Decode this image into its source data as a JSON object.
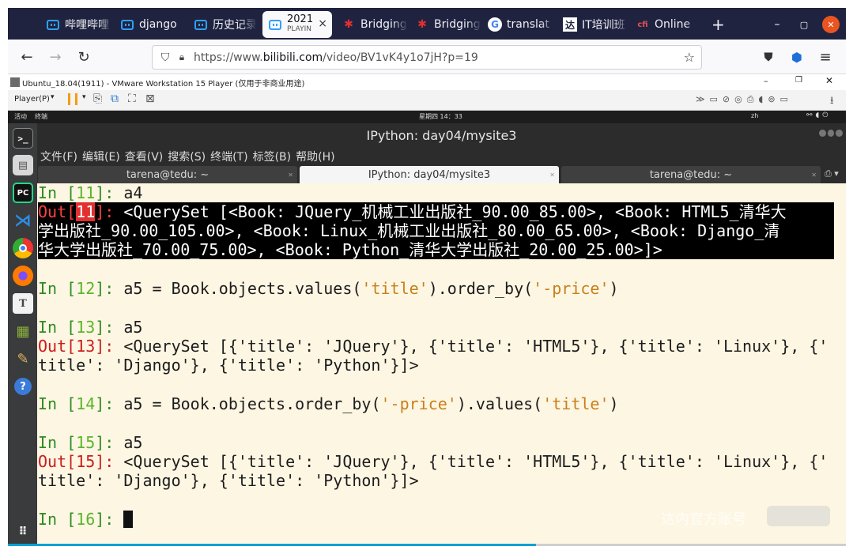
{
  "browser": {
    "tabs": [
      {
        "icon": "bilibili-icon",
        "label": "哔哩哔哩"
      },
      {
        "icon": "bilibili-icon",
        "label": "django"
      },
      {
        "icon": "bilibili-icon",
        "label": "历史记录"
      },
      {
        "icon": "bilibili-icon",
        "label": "2021",
        "sub": "PLAYIN"
      },
      {
        "icon": "maple-leaf-icon",
        "label": "Bridging"
      },
      {
        "icon": "maple-leaf-icon",
        "label": "Bridging"
      },
      {
        "icon": "google-icon",
        "label": "translat"
      },
      {
        "icon": "tarena-icon",
        "label": "IT培训班"
      },
      {
        "icon": "cfi-icon",
        "label": "Online"
      }
    ],
    "new_tab": "+",
    "close_tab": "×",
    "window_controls": {
      "minimize": "–",
      "maximize": "▢",
      "close": "✕"
    },
    "url_prefix": "https://www.",
    "url_domain": "bilibili.com",
    "url_path": "/video/BV1vK4y1o7jH?p=19"
  },
  "vmware": {
    "title": "Ubuntu_18.04(1911) - VMware Workstation 15 Player (仅用于非商业用途)",
    "player_menu": "Player(P)"
  },
  "ubuntu": {
    "activities": "活动",
    "app_menu": "终端",
    "clock": "星期四 14：33",
    "input_method": "zh"
  },
  "terminal": {
    "title": "IPython: day04/mysite3",
    "menu": [
      "文件(F)",
      "编辑(E)",
      "查看(V)",
      "搜索(S)",
      "终端(T)",
      "标签(B)",
      "帮助(H)"
    ],
    "tabs": [
      "tarena@tedu: ~",
      "IPython: day04/mysite3",
      "tarena@tedu: ~"
    ],
    "lines": {
      "l0": {
        "prompt": "In [",
        "num": "11",
        "end": "]: ",
        "code": "a4"
      },
      "l1": {
        "prompt": "Out[",
        "num": "11",
        "end": "]: ",
        "text": "<QuerySet [<Book: JQuery_机械工业出版社_90.00_85.00>, <Book: HTML5_清华大"
      },
      "l2": {
        "text": "学出版社_90.00_105.00>, <Book: Linux_机械工业出版社_80.00_65.00>, <Book: Django_清"
      },
      "l3": {
        "text": "华大学出版社_70.00_75.00>, <Book: Python_清华大学出版社_20.00_25.00>]>"
      },
      "l5": {
        "prompt": "In [",
        "num": "12",
        "end": "]: ",
        "c1": "a5 = Book.objects.values(",
        "s1": "'title'",
        "c2": ").order_by(",
        "s2": "'-price'",
        "c3": ")"
      },
      "l7": {
        "prompt": "In [",
        "num": "13",
        "end": "]: ",
        "code": "a5"
      },
      "l8": {
        "prompt": "Out[",
        "num": "13",
        "end": "]: ",
        "text": "<QuerySet [{'title': 'JQuery'}, {'title': 'HTML5'}, {'title': 'Linux'}, {'"
      },
      "l9": {
        "text": "title': 'Django'}, {'title': 'Python'}]>"
      },
      "l11": {
        "prompt": "In [",
        "num": "14",
        "end": "]: ",
        "c1": "a5 = Book.objects.order_by(",
        "s1": "'-price'",
        "c2": ").values(",
        "s2": "'title'",
        "c3": ")"
      },
      "l13": {
        "prompt": "In [",
        "num": "15",
        "end": "]: ",
        "code": "a5"
      },
      "l14": {
        "prompt": "Out[",
        "num": "15",
        "end": "]: ",
        "text": "<QuerySet [{'title': 'JQuery'}, {'title': 'HTML5'}, {'title': 'Linux'}, {'"
      },
      "l15": {
        "text": "title': 'Django'}, {'title': 'Python'}]>"
      },
      "l17": {
        "prompt": "In [",
        "num": "16",
        "end": "]: "
      }
    }
  },
  "watermark": "达内官方账号",
  "video_progress": 0.63,
  "colors": {
    "terminal_bg": "#fdf6e3",
    "prompt_green": "#2e8b22",
    "out_red": "#cc1b1b",
    "string_orange": "#c7801a",
    "tabstrip": "#202340"
  }
}
